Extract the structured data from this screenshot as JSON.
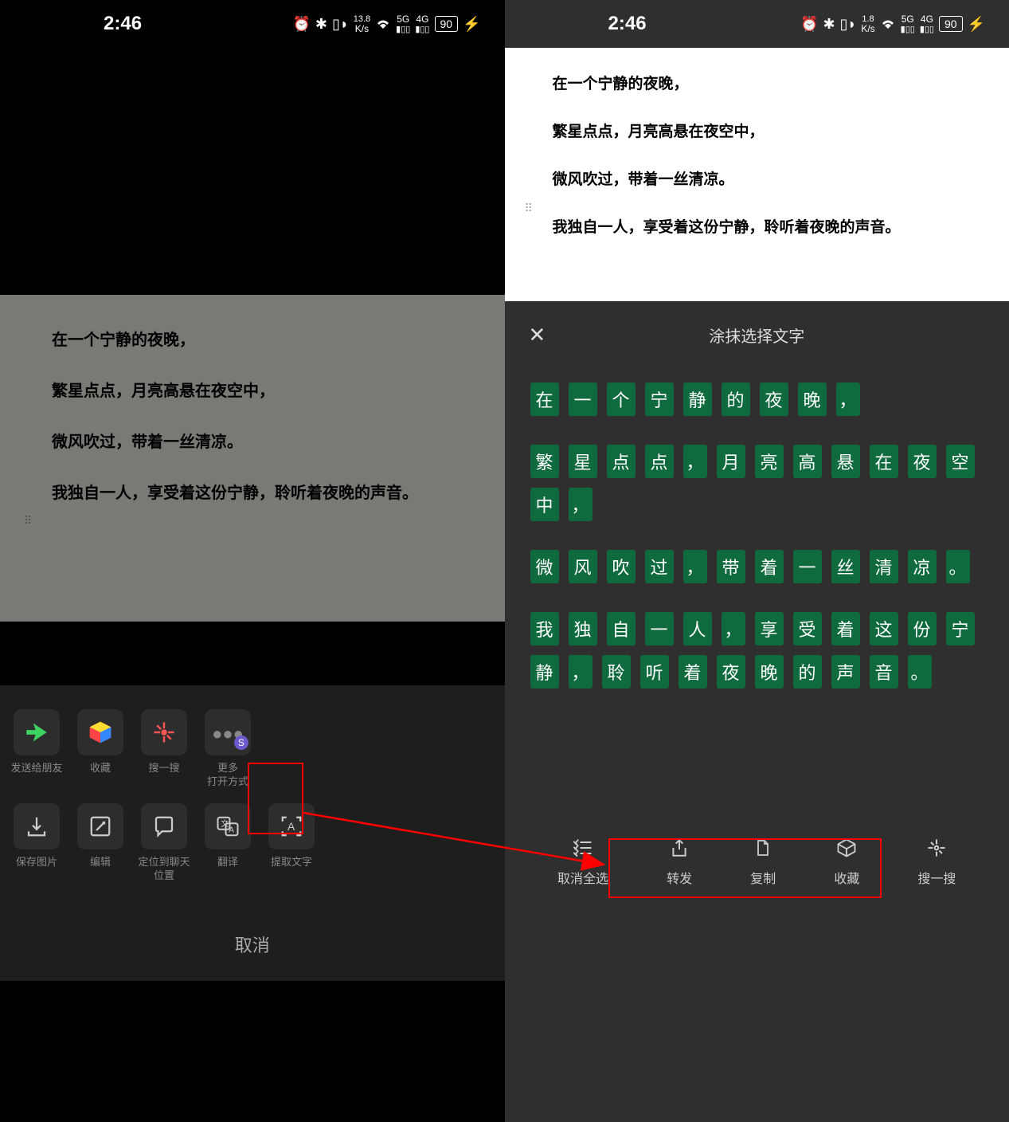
{
  "status": {
    "time": "2:46",
    "speed_left": "13.8",
    "speed_right": "1.8",
    "speed_unit": "K/s",
    "sig1": "5G",
    "sig2": "4G",
    "battery": "90"
  },
  "document": {
    "line1": "在一个宁静的夜晚，",
    "line2": "繁星点点，月亮高悬在夜空中，",
    "line3": "微风吹过，带着一丝清凉。",
    "line4": "我独自一人，享受着这份宁静，聆听着夜晚的声音。"
  },
  "share": {
    "send_friend": "发送给朋友",
    "favorite": "收藏",
    "search": "搜一搜",
    "more_open": "更多\n打开方式",
    "save_image": "保存图片",
    "edit": "编辑",
    "locate_chat": "定位到聊天\n位置",
    "translate": "翻译",
    "extract_text": "提取文字",
    "cancel": "取消"
  },
  "panel": {
    "title": "涂抹选择文字"
  },
  "chars": {
    "sentence1": [
      "在",
      "一",
      "个",
      "宁",
      "静",
      "的",
      "夜",
      "晚",
      "，"
    ],
    "sentence2": [
      "繁",
      "星",
      "点",
      "点",
      "，",
      "月",
      "亮",
      "高",
      "悬",
      "在",
      "夜",
      "空",
      "中",
      "，"
    ],
    "sentence3": [
      "微",
      "风",
      "吹",
      "过",
      "，",
      "带",
      "着",
      "一",
      "丝",
      "清",
      "凉",
      "。"
    ],
    "sentence4": [
      "我",
      "独",
      "自",
      "一",
      "人",
      "，",
      "享",
      "受",
      "着",
      "这",
      "份",
      "宁",
      "静",
      "，",
      "聆",
      "听",
      "着",
      "夜",
      "晚",
      "的",
      "声",
      "音",
      "。"
    ]
  },
  "actions": {
    "deselect_all": "取消全选",
    "forward": "转发",
    "copy": "复制",
    "favorite": "收藏",
    "search": "搜一搜"
  }
}
